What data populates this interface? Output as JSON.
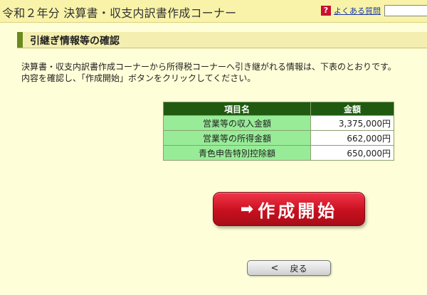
{
  "header": {
    "title": "令和２年分 決算書・収支内訳書作成コーナー",
    "faq_label": "よくある質問",
    "faq_icon": "help-question-icon",
    "brand_color": "#f8f3a8"
  },
  "section": {
    "title": "引継ぎ情報等の確認"
  },
  "description": [
    "決算書・収支内訳書作成コーナーから所得税コーナーへ引き継がれる情報は、下表のとおりです。",
    "内容を確認し、「作成開始」ボタンをクリックしてください。"
  ],
  "table": {
    "headers": [
      "項目名",
      "金額"
    ],
    "rows": [
      [
        "営業等の収入金額",
        "3,375,000円"
      ],
      [
        "営業等の所得金額",
        "662,000円"
      ],
      [
        "青色申告特別控除額",
        "650,000円"
      ]
    ]
  },
  "buttons": {
    "start_label": "作成開始",
    "start_icon": "arrow-right-icon",
    "start_color": "#c8101f",
    "back_label": "戻る",
    "back_icon": "chevron-left-icon"
  }
}
